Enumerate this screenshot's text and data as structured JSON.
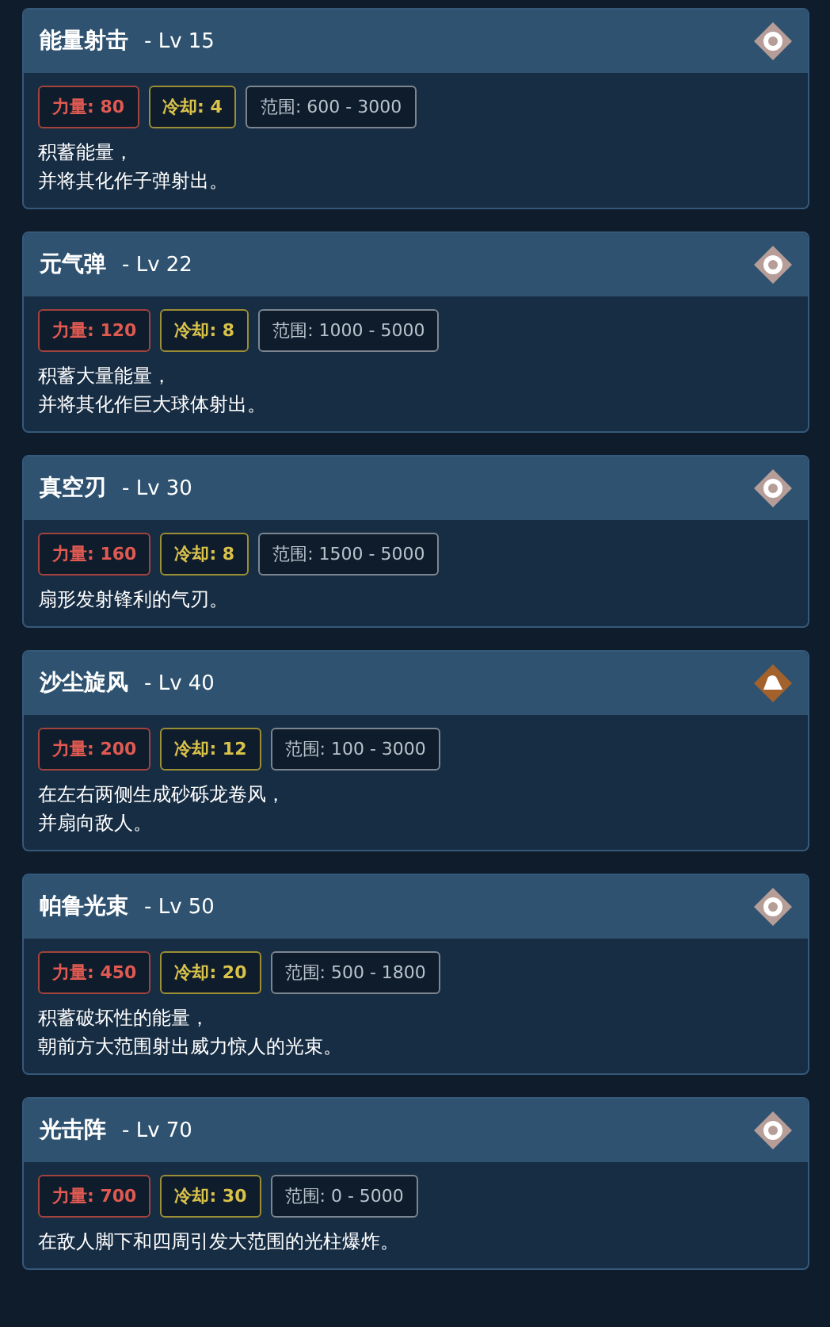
{
  "skills": [
    {
      "name": "能量射击",
      "level": "- Lv 15",
      "kind": "neutral",
      "power": "力量: 80",
      "cooldown": "冷却: 4",
      "range": "范围: 600 - 3000",
      "description": [
        "积蓄能量，",
        "并将其化作子弹射出。"
      ]
    },
    {
      "name": "元气弹",
      "level": "- Lv 22",
      "kind": "neutral",
      "power": "力量: 120",
      "cooldown": "冷却: 8",
      "range": "范围: 1000 - 5000",
      "description": [
        "积蓄大量能量，",
        "并将其化作巨大球体射出。"
      ]
    },
    {
      "name": "真空刃",
      "level": "- Lv 30",
      "kind": "neutral",
      "power": "力量: 160",
      "cooldown": "冷却: 8",
      "range": "范围: 1500 - 5000",
      "description": [
        "扇形发射锋利的气刃。"
      ]
    },
    {
      "name": "沙尘旋风",
      "level": "- Lv 40",
      "kind": "ground",
      "power": "力量: 200",
      "cooldown": "冷却: 12",
      "range": "范围: 100 - 3000",
      "description": [
        "在左右两侧生成砂砾龙卷风，",
        "并扇向敌人。"
      ]
    },
    {
      "name": "帕鲁光束",
      "level": "- Lv 50",
      "kind": "neutral",
      "power": "力量: 450",
      "cooldown": "冷却: 20",
      "range": "范围: 500 - 1800",
      "description": [
        "积蓄破坏性的能量，",
        "朝前方大范围射出威力惊人的光束。"
      ]
    },
    {
      "name": "光击阵",
      "level": "- Lv 70",
      "kind": "neutral",
      "power": "力量: 700",
      "cooldown": "冷却: 30",
      "range": "范围: 0 - 5000",
      "description": [
        "在敌人脚下和四周引发大范围的光柱爆炸。"
      ]
    }
  ]
}
